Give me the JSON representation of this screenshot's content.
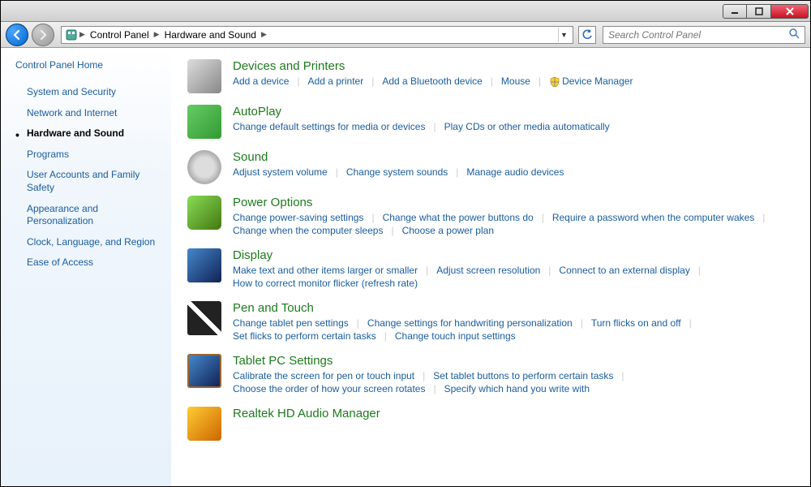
{
  "titlebar": {
    "minimize": "—",
    "maximize": "☐",
    "close": "✕"
  },
  "nav": {
    "back_tooltip": "Back",
    "forward_tooltip": "Forward"
  },
  "breadcrumb": {
    "items": [
      "Control Panel",
      "Hardware and Sound"
    ]
  },
  "search": {
    "placeholder": "Search Control Panel"
  },
  "sidebar": {
    "home": "Control Panel Home",
    "items": [
      {
        "label": "System and Security",
        "active": false
      },
      {
        "label": "Network and Internet",
        "active": false
      },
      {
        "label": "Hardware and Sound",
        "active": true
      },
      {
        "label": "Programs",
        "active": false
      },
      {
        "label": "User Accounts and Family Safety",
        "active": false
      },
      {
        "label": "Appearance and Personalization",
        "active": false
      },
      {
        "label": "Clock, Language, and Region",
        "active": false
      },
      {
        "label": "Ease of Access",
        "active": false
      }
    ]
  },
  "sections": [
    {
      "icon": "printer-icon",
      "title": "Devices and Printers",
      "links": [
        "Add a device",
        "Add a printer",
        "Add a Bluetooth device",
        "Mouse",
        "Device Manager"
      ],
      "shield_on": [
        4
      ]
    },
    {
      "icon": "autoplay-icon",
      "title": "AutoPlay",
      "links": [
        "Change default settings for media or devices",
        "Play CDs or other media automatically"
      ]
    },
    {
      "icon": "sound-icon",
      "title": "Sound",
      "links": [
        "Adjust system volume",
        "Change system sounds",
        "Manage audio devices"
      ]
    },
    {
      "icon": "power-icon",
      "title": "Power Options",
      "links": [
        "Change power-saving settings",
        "Change what the power buttons do",
        "Require a password when the computer wakes",
        "Change when the computer sleeps",
        "Choose a power plan"
      ]
    },
    {
      "icon": "display-icon",
      "title": "Display",
      "links": [
        "Make text and other items larger or smaller",
        "Adjust screen resolution",
        "Connect to an external display",
        "How to correct monitor flicker (refresh rate)"
      ]
    },
    {
      "icon": "pen-icon",
      "title": "Pen and Touch",
      "links": [
        "Change tablet pen settings",
        "Change settings for handwriting personalization",
        "Turn flicks on and off",
        "Set flicks to perform certain tasks",
        "Change touch input settings"
      ]
    },
    {
      "icon": "tablet-icon",
      "title": "Tablet PC Settings",
      "links": [
        "Calibrate the screen for pen or touch input",
        "Set tablet buttons to perform certain tasks",
        "Choose the order of how your screen rotates",
        "Specify which hand you write with"
      ]
    },
    {
      "icon": "realtek-icon",
      "title": "Realtek HD Audio Manager",
      "links": []
    }
  ]
}
